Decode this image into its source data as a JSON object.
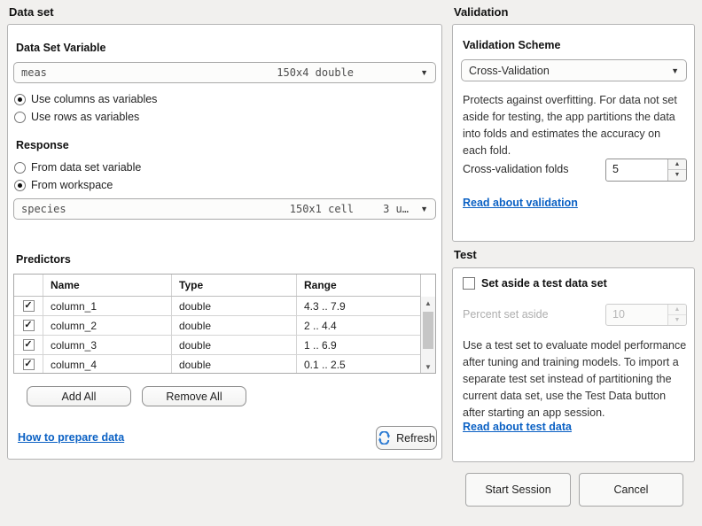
{
  "dataset": {
    "section_title": "Data set",
    "variable_label": "Data Set Variable",
    "variable_combo": {
      "name": "meas",
      "size_type": "150x4 double"
    },
    "orientation_options": [
      {
        "label": "Use columns as variables",
        "selected": true
      },
      {
        "label": "Use rows as variables",
        "selected": false
      }
    ],
    "response_label": "Response",
    "response_options": [
      {
        "label": "From data set variable",
        "selected": false
      },
      {
        "label": "From workspace",
        "selected": true
      }
    ],
    "response_combo": {
      "name": "species",
      "size_type": "150x1 cell",
      "unique": "3 u…"
    },
    "predictors_label": "Predictors",
    "table": {
      "headers": {
        "name": "Name",
        "type": "Type",
        "range": "Range"
      },
      "rows": [
        {
          "checked": true,
          "name": "column_1",
          "type": "double",
          "range": "4.3 .. 7.9"
        },
        {
          "checked": true,
          "name": "column_2",
          "type": "double",
          "range": "2 .. 4.4"
        },
        {
          "checked": true,
          "name": "column_3",
          "type": "double",
          "range": "1 .. 6.9"
        },
        {
          "checked": true,
          "name": "column_4",
          "type": "double",
          "range": "0.1 .. 2.5"
        }
      ]
    },
    "add_all_label": "Add All",
    "remove_all_label": "Remove All",
    "prepare_link": "How to prepare data",
    "refresh_label": "Refresh"
  },
  "validation": {
    "section_title": "Validation",
    "scheme_label": "Validation Scheme",
    "scheme_value": "Cross-Validation",
    "description": "Protects against overfitting. For data not set aside for testing, the app partitions the data into folds and estimates the accuracy on each fold.",
    "folds_label": "Cross-validation folds",
    "folds_value": "5",
    "link": "Read about validation"
  },
  "test": {
    "section_title": "Test",
    "checkbox_label": "Set aside a test data set",
    "checkbox_checked": false,
    "percent_label": "Percent set aside",
    "percent_value": "10",
    "description": "Use a test set to evaluate model performance after tuning and training models. To import a separate test set instead of partitioning the current data set, use the Test Data button after starting an app session.",
    "link": "Read about test data"
  },
  "footer": {
    "start_label": "Start Session",
    "cancel_label": "Cancel"
  },
  "icons": {
    "dropdown_arrow": "▼",
    "spinner_up": "▲",
    "spinner_down": "▼",
    "scroll_up": "▲",
    "scroll_down": "▼",
    "check": "✓"
  },
  "colors": {
    "link_blue": "#0b61c4",
    "refresh_icon_blue": "#2b7ad2",
    "page_background": "#f1f0ee"
  }
}
